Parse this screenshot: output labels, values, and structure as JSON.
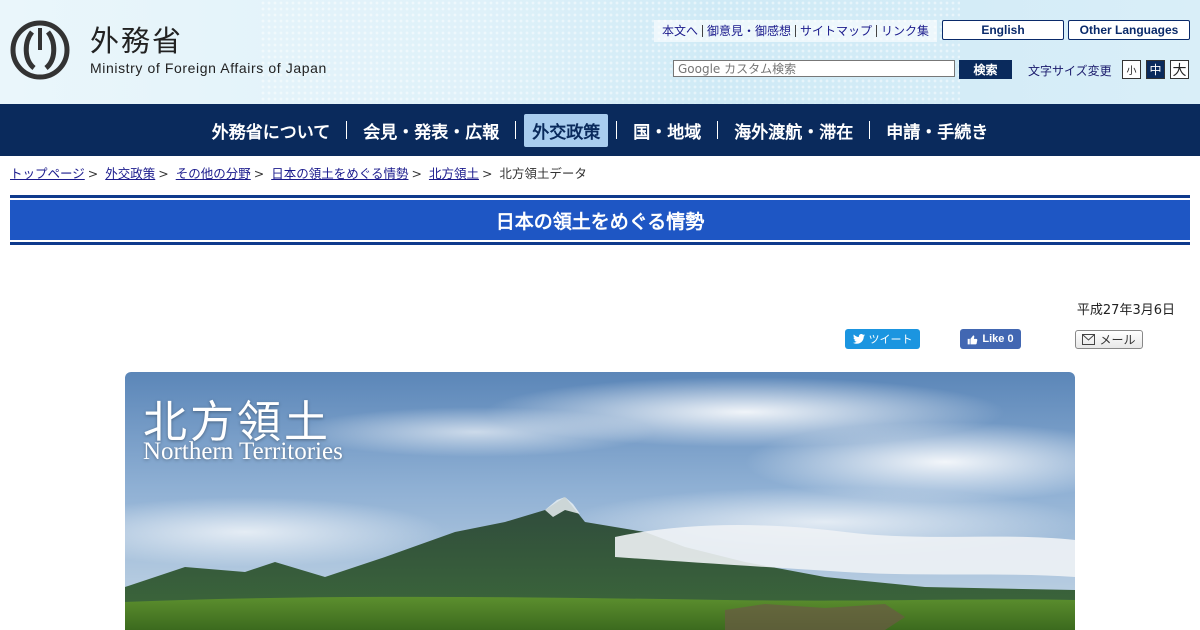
{
  "header": {
    "logo_ja": "外務省",
    "logo_en": "Ministry of Foreign Affairs of Japan",
    "util_links": [
      "本文へ",
      "御意見・御感想",
      "サイトマップ",
      "リンク集"
    ],
    "lang_english": "English",
    "lang_other": "Other Languages",
    "search_placeholder": "Google カスタム検索",
    "search_button": "検索",
    "fontsize_label": "文字サイズ変更",
    "fontsize_small": "小",
    "fontsize_mid": "中",
    "fontsize_large": "大"
  },
  "nav": {
    "items": [
      "外務省について",
      "会見・発表・広報",
      "外交政策",
      "国・地域",
      "海外渡航・滞在",
      "申請・手続き"
    ],
    "active_index": 2
  },
  "breadcrumb": {
    "links": [
      "トップページ",
      "外交政策",
      "その他の分野",
      "日本の領土をめぐる情勢",
      "北方領土"
    ],
    "current": "北方領土データ",
    "separator": ">"
  },
  "page": {
    "title": "日本の領土をめぐる情勢",
    "date": "平成27年3月6日"
  },
  "social": {
    "tweet": "ツイート",
    "like": "Like 0",
    "mail": "メール"
  },
  "hero": {
    "title_ja": "北方領土",
    "title_en": "Northern Territories"
  },
  "colors": {
    "nav_bg": "#0a2a5c",
    "title_bar": "#1e56c4",
    "nav_active": "#a9cdef",
    "link": "#1a1a8c"
  }
}
